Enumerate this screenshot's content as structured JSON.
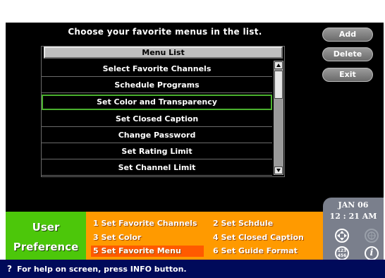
{
  "header": {
    "instruction": "Choose your favorite menus in the list."
  },
  "menu_list": {
    "title": "Menu List",
    "items": [
      "Select Favorite Channels",
      "Schedule Programs",
      "Set Color and Transparency",
      "Set Closed Caption",
      "Change Password",
      "Set Rating Limit",
      "Set Channel Limit"
    ],
    "selected_index": 2
  },
  "buttons": {
    "add": "Add",
    "delete": "Delete",
    "exit": "Exit"
  },
  "bottom_menu": {
    "label_line1": "User",
    "label_line2": "Preference",
    "options": [
      "1 Set Favorite Channels",
      "2 Set Schdule",
      "3 Set Color",
      "4 Set Closed Caption",
      "5 Set Favorite Menu",
      "6 Set Guide Format"
    ],
    "active_index": 4
  },
  "datetime": {
    "date": "JAN 06",
    "time": "12 : 21 AM"
  },
  "icons": {
    "nav": "nav-arrows-icon",
    "guide": "guide-icon",
    "numbers": "number-pad-icon",
    "info": "info-icon"
  },
  "number_icon_text": {
    "top": "123",
    "bottom": "456"
  },
  "info_icon_glyph": "i",
  "help": {
    "icon_glyph": "?",
    "text": "For help on screen, press INFO button."
  },
  "colors": {
    "selected_border": "#4ab02e",
    "bottom_bar": "#ff9a00",
    "active_option": "#ff5a00",
    "menu_label_bg": "#4cc70a",
    "help_bar": "#000a5a"
  }
}
